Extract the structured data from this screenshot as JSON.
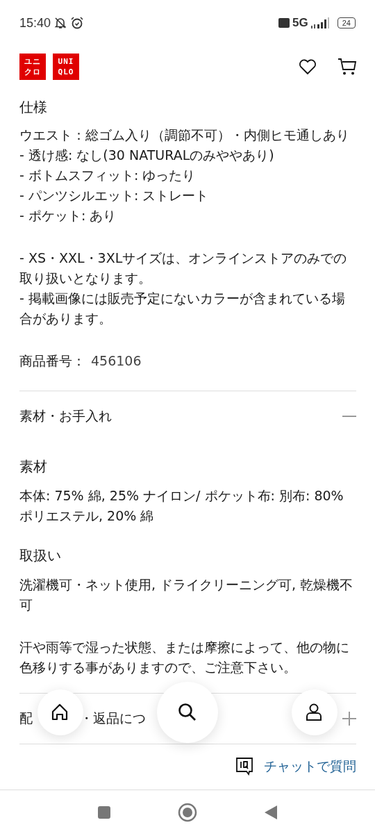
{
  "status_bar": {
    "time": "15:40",
    "network": "5G",
    "battery": "24"
  },
  "header": {
    "logos": [
      [
        "ユニ",
        "クロ"
      ],
      [
        "UNI",
        "QLO"
      ]
    ]
  },
  "spec": {
    "title": "仕様",
    "lines": [
      "ウエスト：総ゴム入り（調節不可）・内側ヒモ通しあり",
      "- 透け感: なし(30 NATURALのみややあり)",
      "- ボトムスフィット: ゆったり",
      "- パンツシルエット: ストレート",
      "- ポケット: あり"
    ],
    "notes": [
      "- XS・XXL・3XLサイズは、オンラインストアのみでの取り扱いとなります。",
      "- 掲載画像には販売予定にないカラーが含まれている場合があります。"
    ],
    "product_number_label": "商品番号：",
    "product_number": "456106"
  },
  "accordions": [
    {
      "title": "素材・お手入れ",
      "expanded": true,
      "sections": [
        {
          "title": "素材",
          "paragraphs": [
            "本体: 75% 綿, 25% ナイロン/ ポケット布: 別布: 80% ポリエステル, 20% 綿"
          ]
        },
        {
          "title": "取扱い",
          "paragraphs": [
            "洗濯機可・ネット使用, ドライクリーニング可, 乾燥機不可",
            "汗や雨等で湿った状態、または摩擦によって、他の物に色移りする事がありますので、ご注意下さい。"
          ]
        }
      ]
    },
    {
      "title_parts": [
        "配",
        "・返品につ"
      ],
      "expanded": false
    }
  ],
  "chat_link": "チャットで質問",
  "floating_nav": [
    {
      "kind": "home"
    },
    {
      "kind": "search"
    },
    {
      "kind": "account"
    }
  ]
}
